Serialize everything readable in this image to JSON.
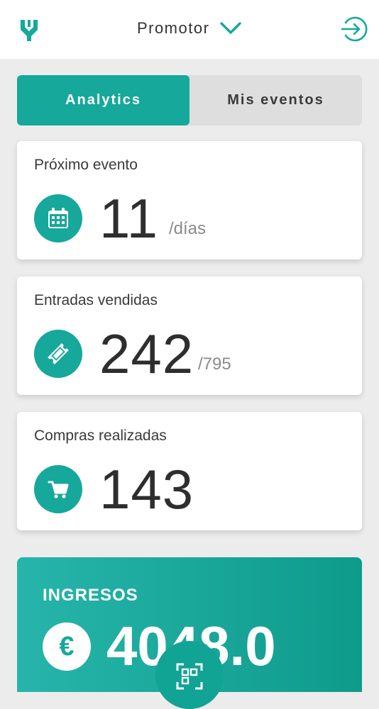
{
  "header": {
    "role_label": "Promotor",
    "accent_color": "#16a89a"
  },
  "tabs": [
    {
      "label": "Analytics",
      "active": true
    },
    {
      "label": "Mis eventos",
      "active": false
    }
  ],
  "cards": [
    {
      "title": "Próximo evento",
      "value": "11",
      "unit": "/días",
      "icon": "calendar-icon"
    },
    {
      "title": "Entradas vendidas",
      "value": "242",
      "unit": "/795",
      "icon": "ticket-icon"
    },
    {
      "title": "Compras realizadas",
      "value": "143",
      "unit": "",
      "icon": "cart-icon"
    }
  ],
  "income": {
    "title": "INGRESOS",
    "currency_symbol": "€",
    "value": "4048.0"
  },
  "icons": {
    "logo": "logo-icon",
    "dropdown": "chevron-down-icon",
    "logout": "logout-icon",
    "scan": "qr-scan-icon"
  }
}
